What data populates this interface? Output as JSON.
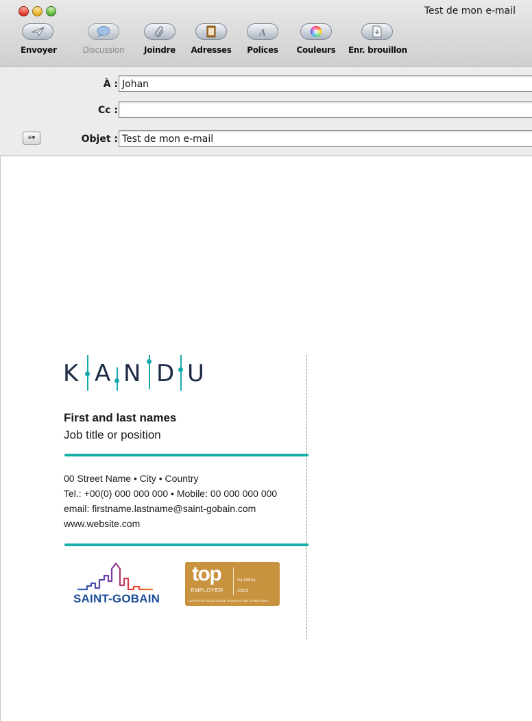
{
  "window": {
    "title": "Test de mon e-mail"
  },
  "toolbar": {
    "items": [
      {
        "label": "Envoyer",
        "icon": "send-icon",
        "enabled": true
      },
      {
        "label": "Discussion",
        "icon": "chat-bubble-icon",
        "enabled": false
      },
      {
        "label": "Joindre",
        "icon": "paperclip-icon",
        "enabled": true
      },
      {
        "label": "Adresses",
        "icon": "address-book-icon",
        "enabled": true
      },
      {
        "label": "Polices",
        "icon": "font-icon",
        "enabled": true
      },
      {
        "label": "Couleurs",
        "icon": "color-wheel-icon",
        "enabled": true
      },
      {
        "label": "Enr. brouillon",
        "icon": "save-draft-icon",
        "enabled": true
      }
    ]
  },
  "header": {
    "to": {
      "label": "À :",
      "value": "Johan"
    },
    "cc": {
      "label": "Cc :",
      "value": ""
    },
    "subject": {
      "label": "Objet :",
      "value": "Test de mon e-mail"
    },
    "options_icon": "header-options-icon"
  },
  "signature": {
    "logo_text": "KANDU",
    "name": "First and last names",
    "position": "Job title or position",
    "address": "00 Street Name • City • Country",
    "phone": "Tel.: +00(0) 000 000 000 • Mobile: 00 000 000 000",
    "email": "email: firstname.lastname@saint-gobain.com",
    "website": "www.website.com",
    "company_logo": "SAINT-GOBAIN",
    "badge": {
      "word": "top",
      "employer": "EMPLOYER",
      "global": "GLOBAL",
      "year": "2022",
      "certified": "CERTIFIED EXCELLENCE IN EMPLOYEE CONDITIONS"
    },
    "accent_color": "#15ada8",
    "brand_blue": "#1b4c99",
    "badge_color": "#c9923f"
  }
}
